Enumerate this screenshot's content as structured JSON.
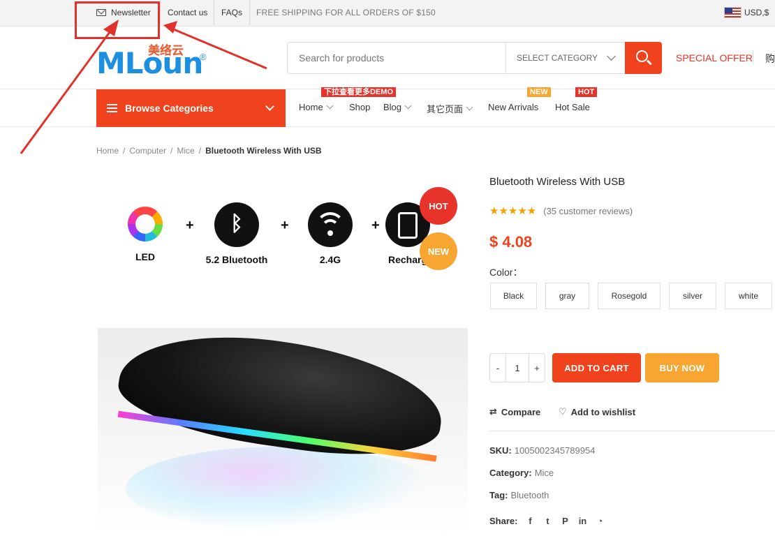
{
  "topbar": {
    "newsletter": "Newsletter",
    "contact": "Contact us",
    "faqs": "FAQs",
    "shipping": "FREE SHIPPING FOR ALL ORDERS OF $150",
    "currency": "USD,$"
  },
  "header": {
    "logo_text": "MLoun",
    "logo_cn": "美络云",
    "logo_reg": "®",
    "search_placeholder": "Search for products",
    "category": "SELECT CATEGORY",
    "special_offer": "SPECIAL OFFER",
    "cart_cn": "购"
  },
  "nav": {
    "browse": "Browse Categories",
    "items": [
      {
        "label": "Home",
        "badge": "下拉查看更多DEMO"
      },
      {
        "label": "Shop"
      },
      {
        "label": "Blog"
      },
      {
        "label": "其它页面"
      },
      {
        "label": "New Arrivals",
        "badge": "NEW"
      },
      {
        "label": "Hot Sale",
        "badge": "HOT"
      }
    ]
  },
  "breadcrumb": [
    "Home",
    "Computer",
    "Mice",
    "Bluetooth Wireless With USB"
  ],
  "gallery": {
    "features": [
      "LED",
      "5.2 Bluetooth",
      "2.4G",
      "Recharg"
    ],
    "hot_badge": "HOT",
    "new_badge": "NEW"
  },
  "product": {
    "title": "Bluetooth Wireless With USB",
    "rating_stars": 5,
    "reviews": "(35 customer reviews)",
    "price": "$ 4.08",
    "color_label": "Color：",
    "colors": [
      "Black",
      "gray",
      "Rosegold",
      "silver",
      "white"
    ],
    "qty_minus": "-",
    "quantity": "1",
    "qty_plus": "+",
    "add_to_cart": "ADD TO CART",
    "buy_now": "BUY NOW",
    "compare": "Compare",
    "wishlist": "Add to wishlist",
    "sku_label": "SKU:",
    "sku": "1005002345789954",
    "category_label": "Category:",
    "category": "Mice",
    "tag_label": "Tag:",
    "tag": "Bluetooth",
    "share_label": "Share:"
  },
  "colors": {
    "accent": "#f0421c",
    "buy": "#f8a531",
    "hot": "#e8332b",
    "new": "#f8a531",
    "annotation": "#e0322b"
  }
}
